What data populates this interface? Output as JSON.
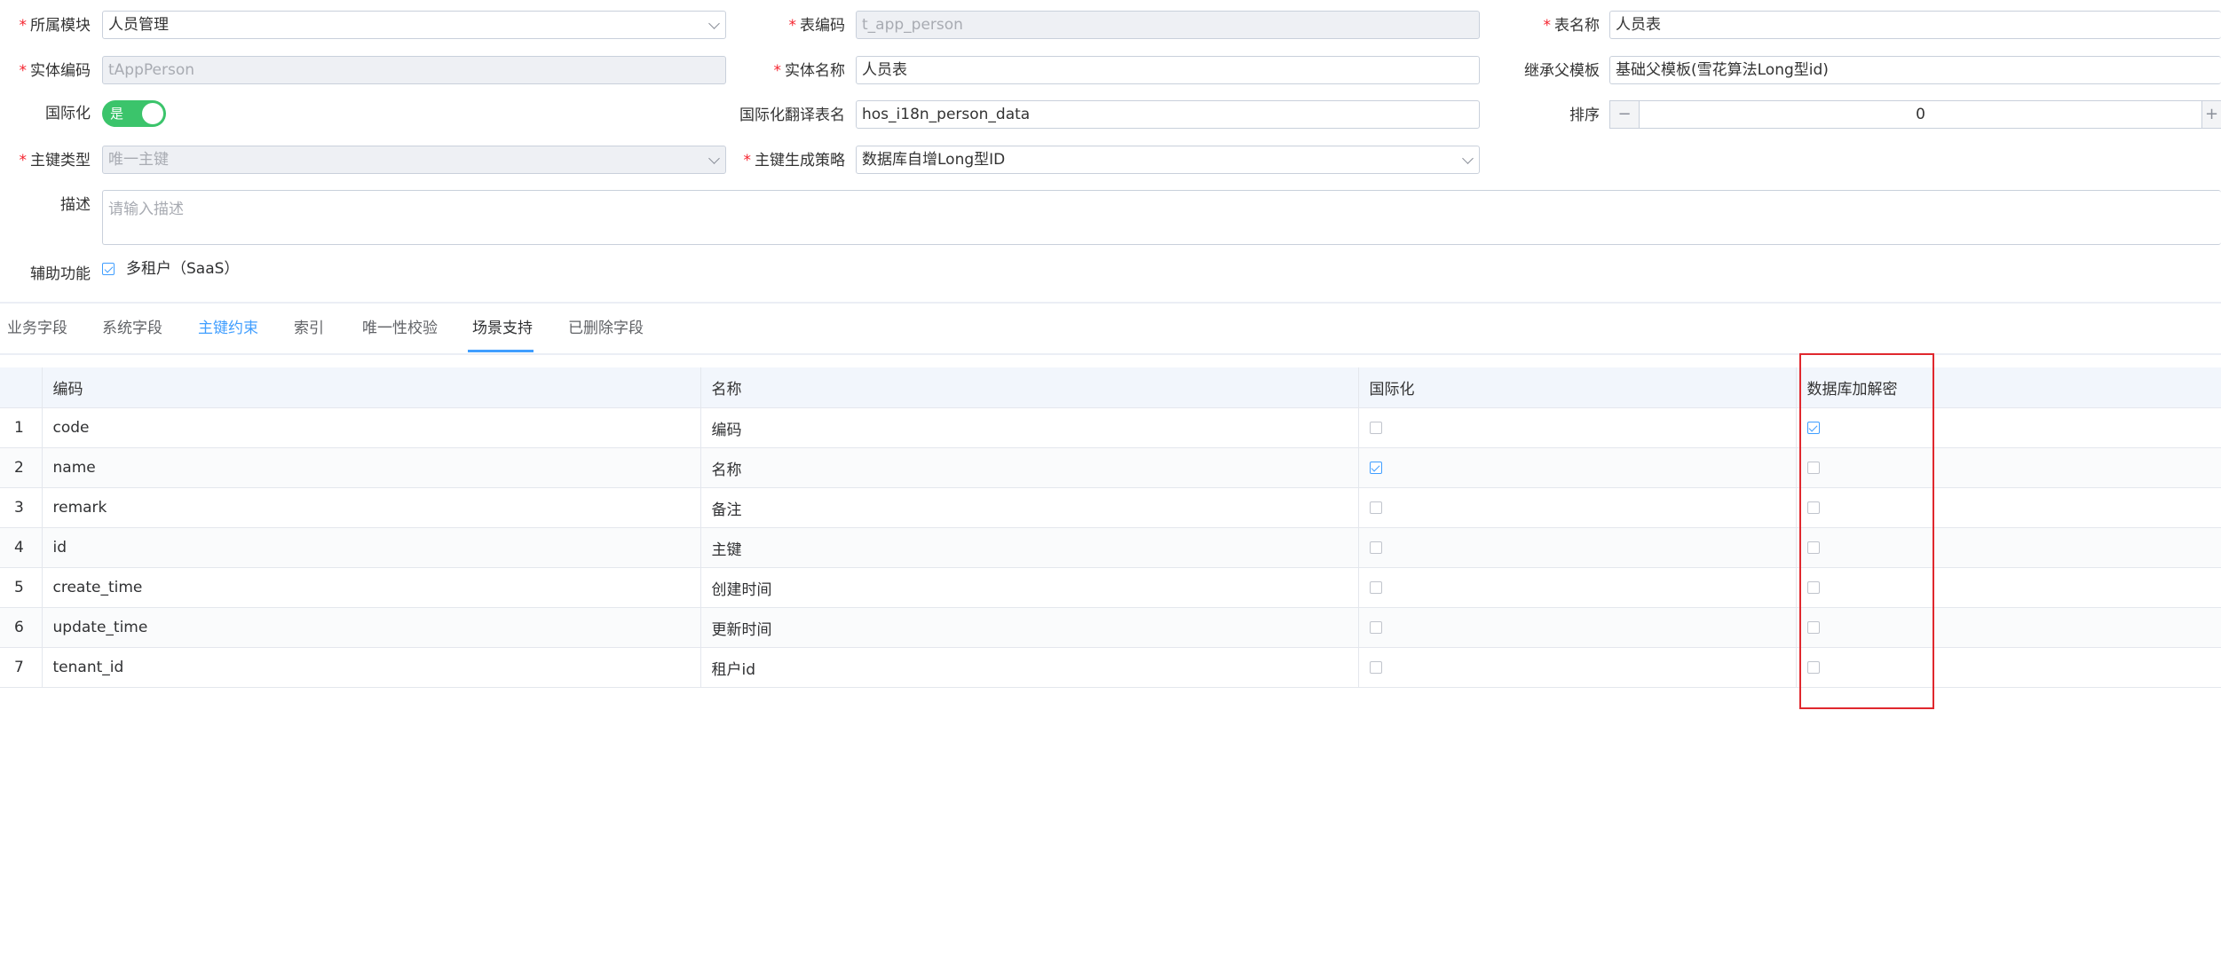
{
  "form": {
    "module": {
      "label": "所属模块",
      "value": "人员管理"
    },
    "table_code": {
      "label": "表编码",
      "value": "t_app_person"
    },
    "table_name": {
      "label": "表名称",
      "value": "人员表"
    },
    "entity_code": {
      "label": "实体编码",
      "value": "tAppPerson"
    },
    "entity_name": {
      "label": "实体名称",
      "value": "人员表"
    },
    "parent_template": {
      "label": "继承父模板",
      "value": "基础父模板(雪花算法Long型id)"
    },
    "i18n": {
      "label": "国际化",
      "switch_text": "是",
      "on": true
    },
    "i18n_table": {
      "label": "国际化翻译表名",
      "value": "hos_i18n_person_data"
    },
    "sort": {
      "label": "排序",
      "value": "0",
      "minus": "−",
      "plus": "+"
    },
    "pk_type": {
      "label": "主键类型",
      "value": "唯一主键"
    },
    "pk_strategy": {
      "label": "主键生成策略",
      "value": "数据库自增Long型ID"
    },
    "description": {
      "label": "描述",
      "placeholder": "请输入描述"
    },
    "aux": {
      "label": "辅助功能",
      "option": "多租户（SaaS）",
      "checked": true
    }
  },
  "tabs": [
    {
      "label": "业务字段"
    },
    {
      "label": "系统字段"
    },
    {
      "label": "主键约束"
    },
    {
      "label": "索引"
    },
    {
      "label": "唯一性校验"
    },
    {
      "label": "场景支持",
      "active": true
    },
    {
      "label": "已删除字段"
    }
  ],
  "table": {
    "columns": [
      "编码",
      "名称",
      "国际化",
      "数据库加解密"
    ],
    "rows": [
      {
        "index": "1",
        "code": "code",
        "name": "编码",
        "i18n": false,
        "encrypt": true
      },
      {
        "index": "2",
        "code": "name",
        "name": "名称",
        "i18n": true,
        "encrypt": false
      },
      {
        "index": "3",
        "code": "remark",
        "name": "备注",
        "i18n": false,
        "encrypt": false
      },
      {
        "index": "4",
        "code": "id",
        "name": "主键",
        "i18n": false,
        "encrypt": false
      },
      {
        "index": "5",
        "code": "create_time",
        "name": "创建时间",
        "i18n": false,
        "encrypt": false
      },
      {
        "index": "6",
        "code": "update_time",
        "name": "更新时间",
        "i18n": false,
        "encrypt": false
      },
      {
        "index": "7",
        "code": "tenant_id",
        "name": "租户id",
        "i18n": false,
        "encrypt": false
      }
    ]
  },
  "colors": {
    "accent": "#409eff",
    "switch_on": "#3bc46b",
    "highlight": "#e0282e",
    "required": "#f5222d"
  }
}
